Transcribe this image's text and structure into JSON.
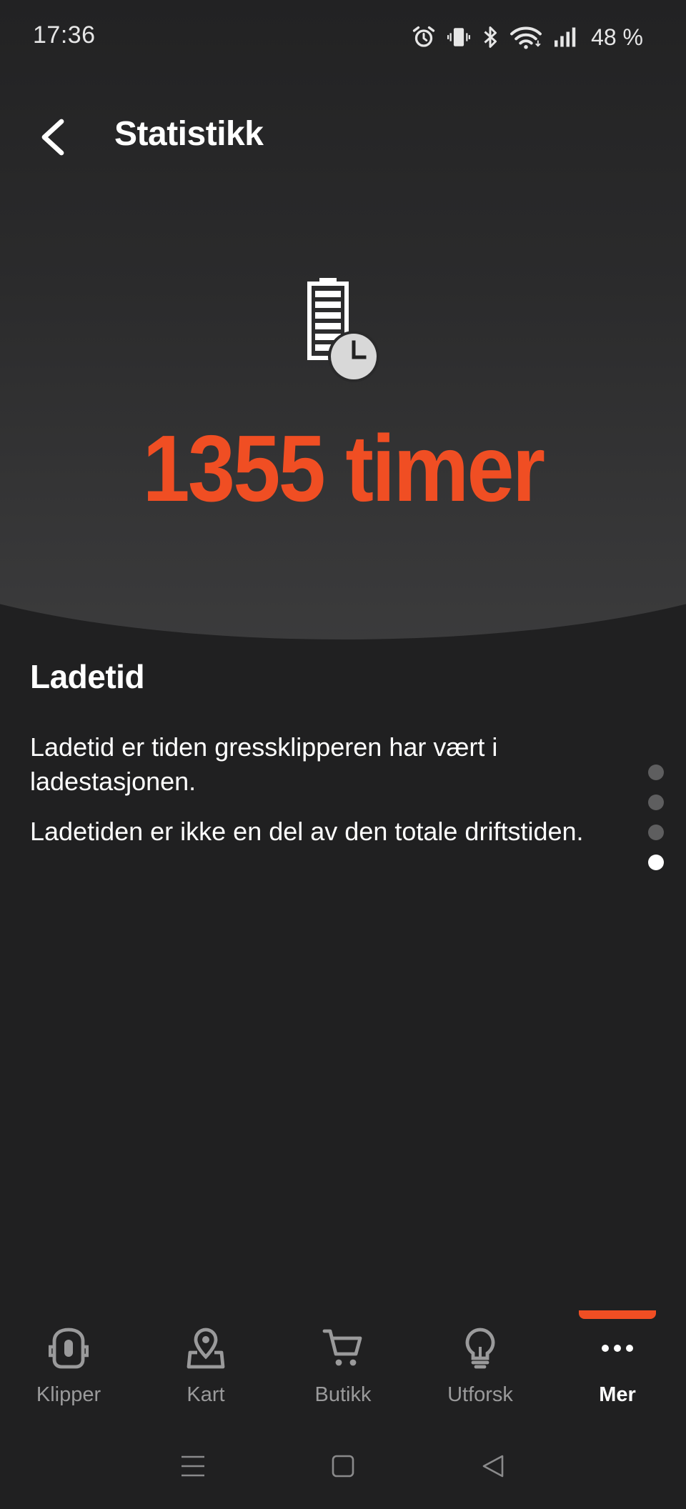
{
  "status_bar": {
    "time": "17:36",
    "battery": "48 %",
    "icons": [
      "alarm-icon",
      "vibrate-icon",
      "bluetooth-icon",
      "wifi-icon",
      "signal-icon"
    ]
  },
  "header": {
    "title": "Statistikk",
    "back_icon": "chevron-left-icon"
  },
  "stat": {
    "icon": "battery-clock-icon",
    "value": "1355 timer"
  },
  "content": {
    "title": "Ladetid",
    "paragraphs": [
      "Ladetid er tiden gressklipperen har vært i ladestasjonen.",
      "Ladetiden er ikke en del av den totale driftstiden."
    ]
  },
  "pager": {
    "count": 4,
    "active_index": 3
  },
  "bottom_nav": {
    "items": [
      {
        "label": "Klipper",
        "icon": "mower-icon"
      },
      {
        "label": "Kart",
        "icon": "map-pin-icon"
      },
      {
        "label": "Butikk",
        "icon": "cart-icon"
      },
      {
        "label": "Utforsk",
        "icon": "lightbulb-icon"
      },
      {
        "label": "Mer",
        "icon": "more-dots-icon",
        "active": true
      }
    ]
  },
  "colors": {
    "accent": "#f04e23",
    "background": "#202021"
  }
}
